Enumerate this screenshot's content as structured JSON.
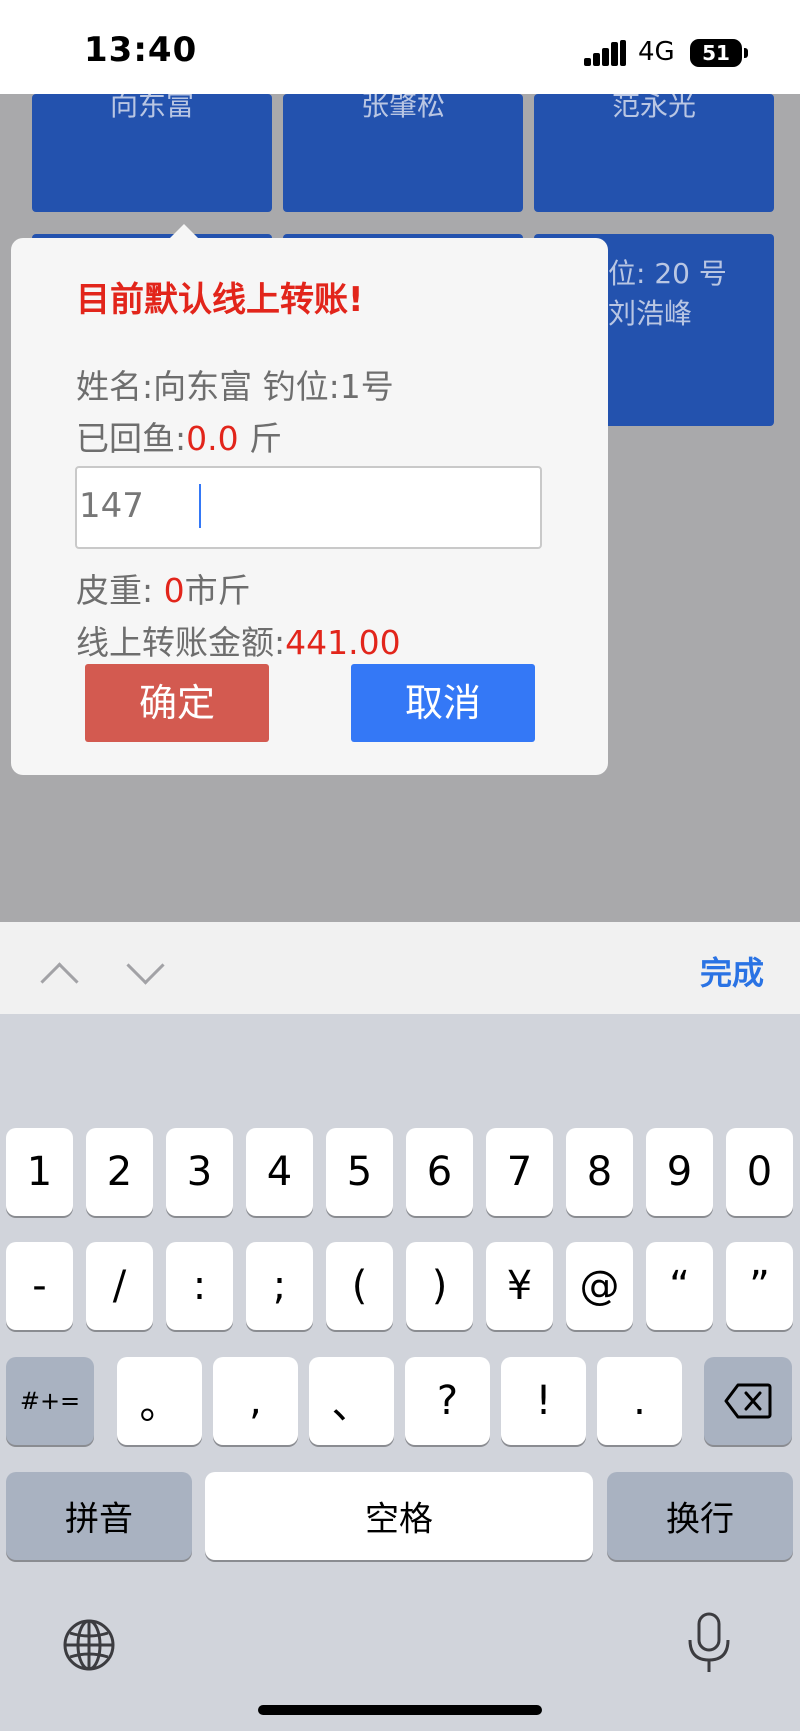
{
  "status_bar": {
    "time": "13:40",
    "network": "4G",
    "battery": "51"
  },
  "background_tiles": {
    "row1_names": [
      "向东富",
      "张肇松",
      "范永光"
    ],
    "tile_partial_line1": "位: 20 号",
    "tile_partial_line2": "刘浩峰"
  },
  "dialog": {
    "title": "目前默认线上转账!",
    "name_label": "姓名:",
    "name": "向东富",
    "seat_label": "钓位:",
    "seat": "1号",
    "returned_label": "已回鱼:",
    "returned_value": "0.0",
    "returned_unit": "斤",
    "input_value": "147",
    "tare_label": "皮重:",
    "tare_value": "0",
    "tare_unit": "市斤",
    "amount_label": "线上转账金额:",
    "amount_value": "441.00",
    "confirm_label": "确定",
    "cancel_label": "取消"
  },
  "keyboard": {
    "done_label": "完成",
    "row1": [
      "1",
      "2",
      "3",
      "4",
      "5",
      "6",
      "7",
      "8",
      "9",
      "0"
    ],
    "row2": [
      "-",
      "/",
      ":",
      ";",
      "(",
      ")",
      "¥",
      "@",
      "“",
      "”"
    ],
    "row3_switch": "#+=",
    "row3": [
      "。",
      ",",
      "、",
      "?",
      "!",
      "."
    ],
    "pinyin_label": "拼音",
    "space_label": "空格",
    "return_label": "换行"
  },
  "icons": [
    "signal-icon",
    "battery-icon",
    "chevron-up-icon",
    "chevron-down-icon",
    "backspace-icon",
    "globe-icon",
    "microphone-icon"
  ]
}
